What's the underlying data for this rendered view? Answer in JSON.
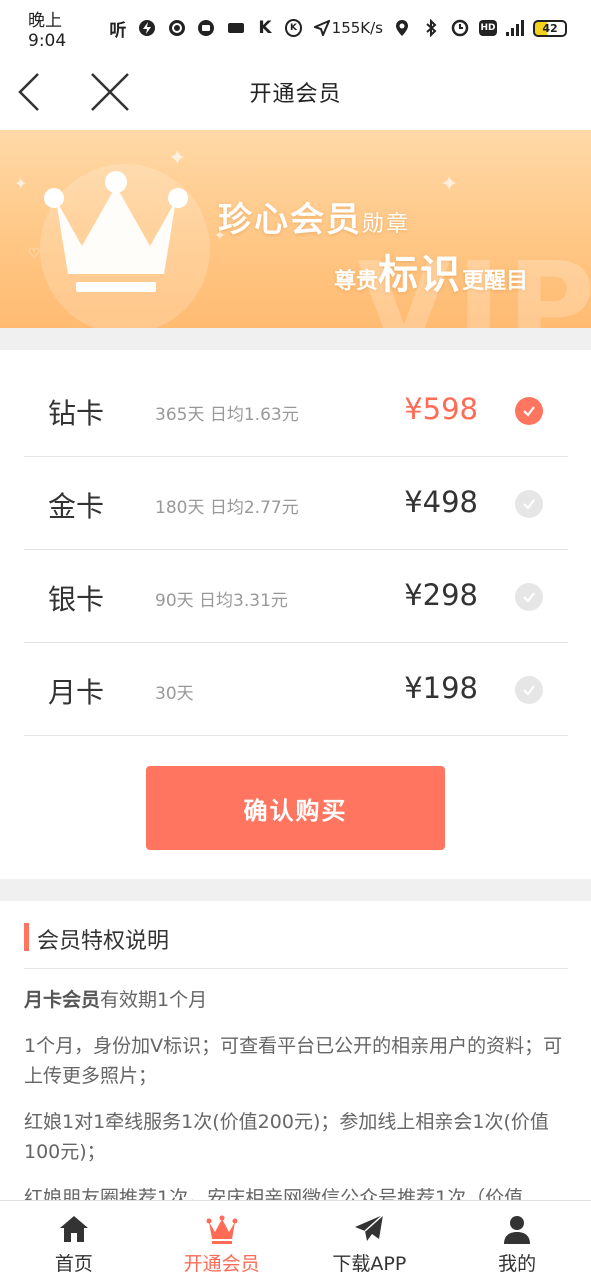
{
  "status_bar": {
    "time": "晚上9:04",
    "network_speed": "155K/s",
    "battery": "42",
    "icons": [
      "listen-icon",
      "flash-icon",
      "qq-icon",
      "message-icon",
      "app-icon",
      "k-icon",
      "k-circle-icon",
      "location-arrow-icon",
      "location-pin-icon",
      "bluetooth-icon",
      "alarm-icon",
      "hd-icon",
      "signal-icon",
      "battery-icon"
    ]
  },
  "nav": {
    "title": "开通会员"
  },
  "banner": {
    "line1_main": "珍心会员",
    "line1_small": "勋章",
    "line2_left": "尊贵",
    "line2_big": "标识",
    "line2_right": "更醒目",
    "ghost": "VIP"
  },
  "plans": [
    {
      "name": "钻卡",
      "desc": "365天 日均1.63元",
      "price": "¥598",
      "selected": true
    },
    {
      "name": "金卡",
      "desc": "180天 日均2.77元",
      "price": "¥498",
      "selected": false
    },
    {
      "name": "银卡",
      "desc": "90天 日均3.31元",
      "price": "¥298",
      "selected": false
    },
    {
      "name": "月卡",
      "desc": "30天",
      "price": "¥198",
      "selected": false
    }
  ],
  "confirm_label": "确认购买",
  "privileges": {
    "title": "会员特权说明",
    "p1_bold": "月卡会员",
    "p1_rest": "有效期1个月",
    "p2": "1个月，身份加V标识；可查看平台已公开的相亲用户的资料；可上传更多照片；",
    "p3": "红娘1对1牵线服务1次(价值200元)；参加线上相亲会1次(价值100元)；",
    "p4": "红娘朋友圈推荐1次，安庆相亲网微信公众号推荐1次（价值"
  },
  "tabs": [
    {
      "label": "首页",
      "icon": "home-icon"
    },
    {
      "label": "开通会员",
      "icon": "crown-icon"
    },
    {
      "label": "下载APP",
      "icon": "paper-plane-icon"
    },
    {
      "label": "我的",
      "icon": "user-icon"
    }
  ],
  "colors": {
    "accent": "#ff7560",
    "price_selected": "#ff6b55",
    "banner_top": "#ffd9a8",
    "banner_bottom": "#ffbb72",
    "check_off": "#e6e6e6"
  }
}
